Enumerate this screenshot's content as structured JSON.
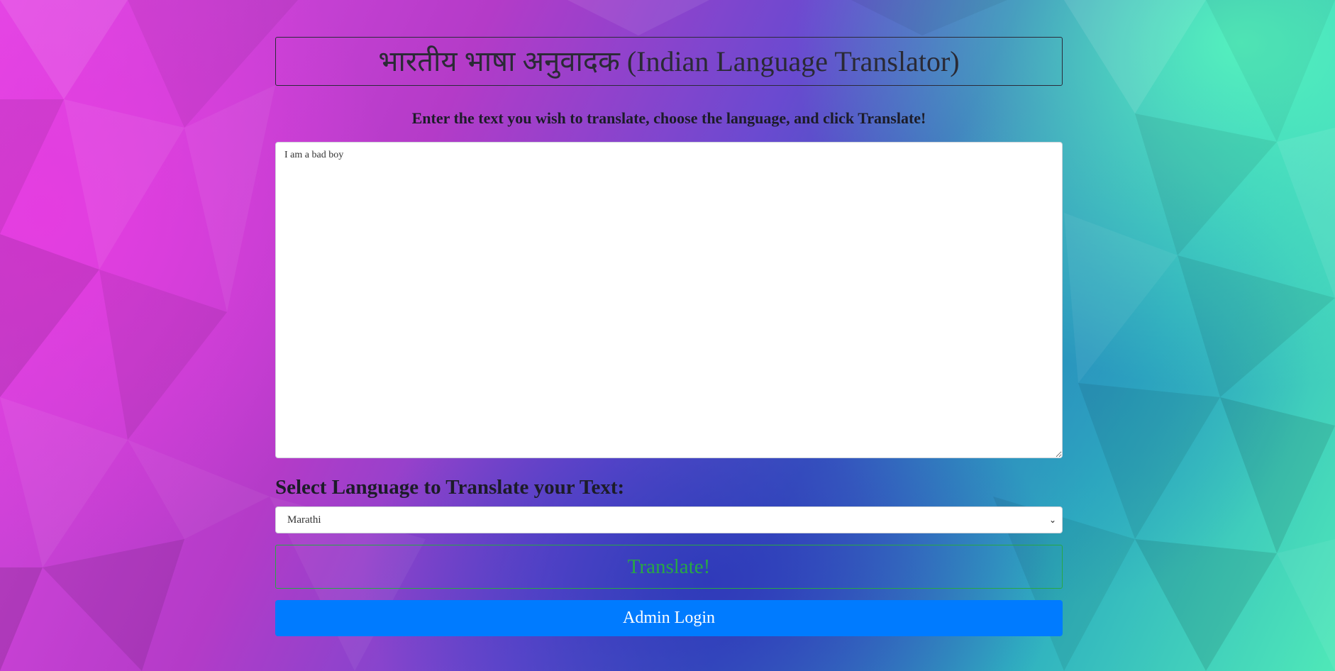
{
  "page": {
    "title": "भारतीय भाषा अनुवादक (Indian Language Translator)",
    "instruction": "Enter the text you wish to translate, choose the language, and click Translate!"
  },
  "input": {
    "value": "I am a bad boy"
  },
  "language": {
    "label": "Select Language to Translate your Text:",
    "selected": "Marathi",
    "chevron_icon": "chevron-down-icon"
  },
  "buttons": {
    "translate": "Translate!",
    "admin_login": "Admin Login"
  },
  "colors": {
    "translate_accent": "#28a745",
    "admin_button": "#007bff"
  }
}
